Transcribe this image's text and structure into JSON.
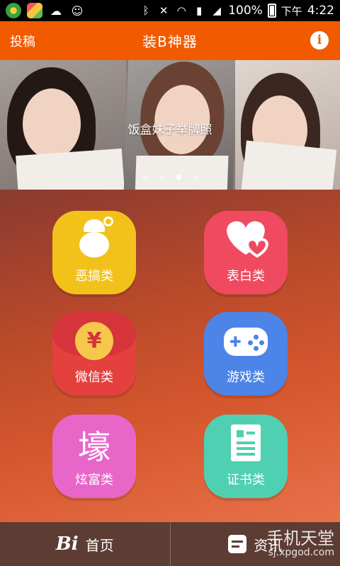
{
  "status_bar": {
    "time_prefix": "下午",
    "time": "4:22",
    "battery": "100%",
    "icons": [
      "app-icon",
      "gallery-icon",
      "cloud-icon",
      "robot-icon",
      "bluetooth-icon",
      "mute-icon",
      "wifi-icon",
      "sim-icon",
      "signal-icon",
      "battery-icon"
    ]
  },
  "app_bar": {
    "contribute_label": "投稿",
    "title": "装B神器",
    "info_icon": "i"
  },
  "banner": {
    "caption": "饭盒妹子举牌照",
    "page_count": 4,
    "active_page": 3
  },
  "categories": [
    {
      "label": "恶搞类",
      "icon": "clown-icon",
      "color": "#f2c21a"
    },
    {
      "label": "表白类",
      "icon": "hearts-icon",
      "color": "#ef4a5f"
    },
    {
      "label": "微信类",
      "icon": "red-envelope-icon",
      "glyph": "¥",
      "color": "#e3403e"
    },
    {
      "label": "游戏类",
      "icon": "gamepad-icon",
      "color": "#4c84e8"
    },
    {
      "label": "炫富类",
      "icon": "rich-char-icon",
      "glyph": "壕",
      "color": "#e866c8"
    },
    {
      "label": "证书类",
      "icon": "certificate-icon",
      "color": "#4fd0b2"
    }
  ],
  "bottom_nav": {
    "home_logo": "Bi",
    "home_label": "首页",
    "news_label": "资讯"
  },
  "watermark": {
    "title": "手机天堂",
    "url": "sj.xpgod.com"
  }
}
